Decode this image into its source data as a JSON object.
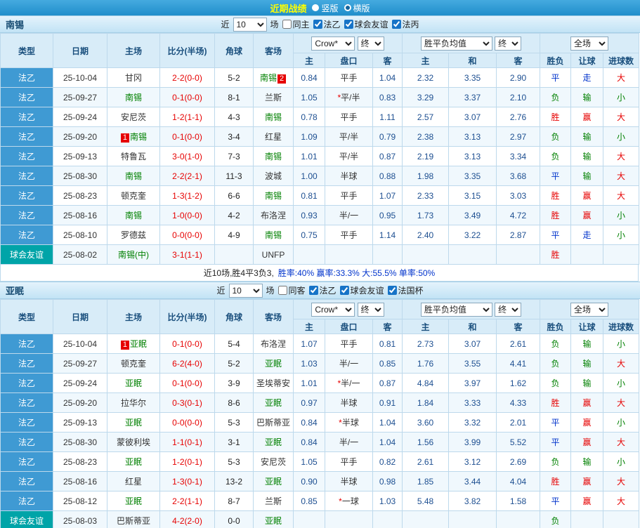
{
  "top_bar": {
    "title": "近期战绩",
    "layout_options": [
      {
        "label": "竖版",
        "selected": false
      },
      {
        "label": "横版",
        "selected": true
      }
    ]
  },
  "palette": {
    "topbar_blue": "#2f9ad3",
    "title_yellow": "#ffff00",
    "league_blue": "#3f9ad3",
    "friendly_teal": "#00a4a8",
    "win_red": "#e60000",
    "draw_blue": "#0033cc",
    "loss_green": "#008000",
    "odds_navy": "#1d4f91"
  },
  "sections": [
    {
      "team": "南锡",
      "filters": {
        "near_label": "近",
        "count_value": "10",
        "unit_label": "场",
        "checkboxes": [
          {
            "label": "同主",
            "checked": false
          },
          {
            "label": "法乙",
            "checked": true
          },
          {
            "label": "球会友谊",
            "checked": true
          },
          {
            "label": "法丙",
            "checked": true
          }
        ]
      },
      "selectors": {
        "odds_company": "Crow*",
        "odds_stage": "终",
        "europe_odds": "胜平负均值",
        "europe_stage": "终",
        "scope": "全场"
      },
      "columns": {
        "static": [
          "类型",
          "日期",
          "主场",
          "比分(半场)",
          "角球",
          "客场"
        ],
        "asia": [
          "主",
          "盘口",
          "客"
        ],
        "europe": [
          "主",
          "和",
          "客"
        ],
        "scope": [
          "胜负",
          "让球",
          "进球数"
        ]
      },
      "rows": [
        {
          "type": "法乙",
          "date": "25-10-04",
          "home": "甘冈",
          "home_focal": false,
          "score": "2-2(0-0)",
          "corner": "5-2",
          "away": "南锡",
          "away_focal": true,
          "away_badge": "2",
          "away_badge_side": "right",
          "asia_home": "0.84",
          "handicap": "平手",
          "asia_away": "1.04",
          "euro_home": "2.32",
          "euro_draw": "3.35",
          "euro_away": "2.90",
          "result": "平",
          "handicap_result": "走",
          "goals": "大"
        },
        {
          "type": "法乙",
          "date": "25-09-27",
          "home": "南锡",
          "home_focal": true,
          "score": "0-1(0-0)",
          "corner": "8-1",
          "away": "兰斯",
          "away_focal": false,
          "asia_home": "1.05",
          "handicap": "*平/半",
          "asia_away": "0.83",
          "euro_home": "3.29",
          "euro_draw": "3.37",
          "euro_away": "2.10",
          "result": "负",
          "handicap_result": "输",
          "goals": "小"
        },
        {
          "type": "法乙",
          "date": "25-09-24",
          "home": "安尼茨",
          "home_focal": false,
          "score": "1-2(1-1)",
          "corner": "4-3",
          "away": "南锡",
          "away_focal": true,
          "asia_home": "0.78",
          "handicap": "平手",
          "asia_away": "1.11",
          "euro_home": "2.57",
          "euro_draw": "3.07",
          "euro_away": "2.76",
          "result": "胜",
          "handicap_result": "赢",
          "goals": "大"
        },
        {
          "type": "法乙",
          "date": "25-09-20",
          "home": "南锡",
          "home_focal": true,
          "home_badge": "1",
          "home_badge_side": "left",
          "score": "0-1(0-0)",
          "corner": "3-4",
          "away": "红星",
          "away_focal": false,
          "asia_home": "1.09",
          "handicap": "平/半",
          "asia_away": "0.79",
          "euro_home": "2.38",
          "euro_draw": "3.13",
          "euro_away": "2.97",
          "result": "负",
          "handicap_result": "输",
          "goals": "小"
        },
        {
          "type": "法乙",
          "date": "25-09-13",
          "home": "特鲁瓦",
          "home_focal": false,
          "score": "3-0(1-0)",
          "corner": "7-3",
          "away": "南锡",
          "away_focal": true,
          "asia_home": "1.01",
          "handicap": "平/半",
          "asia_away": "0.87",
          "euro_home": "2.19",
          "euro_draw": "3.13",
          "euro_away": "3.34",
          "result": "负",
          "handicap_result": "输",
          "goals": "大"
        },
        {
          "type": "法乙",
          "date": "25-08-30",
          "home": "南锡",
          "home_focal": true,
          "score": "2-2(2-1)",
          "corner": "11-3",
          "away": "波城",
          "away_focal": false,
          "asia_home": "1.00",
          "handicap": "半球",
          "asia_away": "0.88",
          "euro_home": "1.98",
          "euro_draw": "3.35",
          "euro_away": "3.68",
          "result": "平",
          "handicap_result": "输",
          "goals": "大"
        },
        {
          "type": "法乙",
          "date": "25-08-23",
          "home": "顿克奎",
          "home_focal": false,
          "score": "1-3(1-2)",
          "corner": "6-6",
          "away": "南锡",
          "away_focal": true,
          "asia_home": "0.81",
          "handicap": "平手",
          "asia_away": "1.07",
          "euro_home": "2.33",
          "euro_draw": "3.15",
          "euro_away": "3.03",
          "result": "胜",
          "handicap_result": "赢",
          "goals": "大"
        },
        {
          "type": "法乙",
          "date": "25-08-16",
          "home": "南锡",
          "home_focal": true,
          "score": "1-0(0-0)",
          "corner": "4-2",
          "away": "布洛涅",
          "away_focal": false,
          "asia_home": "0.93",
          "handicap": "半/一",
          "asia_away": "0.95",
          "euro_home": "1.73",
          "euro_draw": "3.49",
          "euro_away": "4.72",
          "result": "胜",
          "handicap_result": "赢",
          "goals": "小"
        },
        {
          "type": "法乙",
          "date": "25-08-10",
          "home": "罗德兹",
          "home_focal": false,
          "score": "0-0(0-0)",
          "corner": "4-9",
          "away": "南锡",
          "away_focal": true,
          "asia_home": "0.75",
          "handicap": "平手",
          "asia_away": "1.14",
          "euro_home": "2.40",
          "euro_draw": "3.22",
          "euro_away": "2.87",
          "result": "平",
          "handicap_result": "走",
          "goals": "小"
        },
        {
          "type": "球会友谊",
          "date": "25-08-02",
          "home": "南锡(中)",
          "home_focal": true,
          "score": "3-1(1-1)",
          "corner": "",
          "away": "UNFP",
          "away_focal": false,
          "asia_home": "",
          "handicap": "",
          "asia_away": "",
          "euro_home": "",
          "euro_draw": "",
          "euro_away": "",
          "result": "胜",
          "handicap_result": "",
          "goals": ""
        }
      ],
      "summary": {
        "prefix": "近10场,胜4平3负3,",
        "stats": "胜率:40% 赢率:33.3% 大:55.5% 单率:50%"
      }
    },
    {
      "team": "亚眠",
      "filters": {
        "near_label": "近",
        "count_value": "10",
        "unit_label": "场",
        "checkboxes": [
          {
            "label": "同客",
            "checked": false
          },
          {
            "label": "法乙",
            "checked": true
          },
          {
            "label": "球会友谊",
            "checked": true
          },
          {
            "label": "法国杯",
            "checked": true
          }
        ]
      },
      "selectors": {
        "odds_company": "Crow*",
        "odds_stage": "终",
        "europe_odds": "胜平负均值",
        "europe_stage": "终",
        "scope": "全场"
      },
      "columns": {
        "static": [
          "类型",
          "日期",
          "主场",
          "比分(半场)",
          "角球",
          "客场"
        ],
        "asia": [
          "主",
          "盘口",
          "客"
        ],
        "europe": [
          "主",
          "和",
          "客"
        ],
        "scope": [
          "胜负",
          "让球",
          "进球数"
        ]
      },
      "rows": [
        {
          "type": "法乙",
          "date": "25-10-04",
          "home": "亚眠",
          "home_focal": true,
          "home_badge": "1",
          "home_badge_side": "left",
          "score": "0-1(0-0)",
          "corner": "5-4",
          "away": "布洛涅",
          "away_focal": false,
          "asia_home": "1.07",
          "handicap": "平手",
          "asia_away": "0.81",
          "euro_home": "2.73",
          "euro_draw": "3.07",
          "euro_away": "2.61",
          "result": "负",
          "handicap_result": "输",
          "goals": "小"
        },
        {
          "type": "法乙",
          "date": "25-09-27",
          "home": "顿克奎",
          "home_focal": false,
          "score": "6-2(4-0)",
          "corner": "5-2",
          "away": "亚眠",
          "away_focal": true,
          "asia_home": "1.03",
          "handicap": "半/一",
          "asia_away": "0.85",
          "euro_home": "1.76",
          "euro_draw": "3.55",
          "euro_away": "4.41",
          "result": "负",
          "handicap_result": "输",
          "goals": "大"
        },
        {
          "type": "法乙",
          "date": "25-09-24",
          "home": "亚眠",
          "home_focal": true,
          "score": "0-1(0-0)",
          "corner": "3-9",
          "away": "圣埃蒂安",
          "away_focal": false,
          "asia_home": "1.01",
          "handicap": "*半/一",
          "asia_away": "0.87",
          "euro_home": "4.84",
          "euro_draw": "3.97",
          "euro_away": "1.62",
          "result": "负",
          "handicap_result": "输",
          "goals": "小"
        },
        {
          "type": "法乙",
          "date": "25-09-20",
          "home": "拉华尔",
          "home_focal": false,
          "score": "0-3(0-1)",
          "corner": "8-6",
          "away": "亚眠",
          "away_focal": true,
          "asia_home": "0.97",
          "handicap": "半球",
          "asia_away": "0.91",
          "euro_home": "1.84",
          "euro_draw": "3.33",
          "euro_away": "4.33",
          "result": "胜",
          "handicap_result": "赢",
          "goals": "大"
        },
        {
          "type": "法乙",
          "date": "25-09-13",
          "home": "亚眠",
          "home_focal": true,
          "score": "0-0(0-0)",
          "corner": "5-3",
          "away": "巴斯蒂亚",
          "away_focal": false,
          "asia_home": "0.84",
          "handicap": "*半球",
          "asia_away": "1.04",
          "euro_home": "3.60",
          "euro_draw": "3.32",
          "euro_away": "2.01",
          "result": "平",
          "handicap_result": "赢",
          "goals": "小"
        },
        {
          "type": "法乙",
          "date": "25-08-30",
          "home": "蒙彼利埃",
          "home_focal": false,
          "score": "1-1(0-1)",
          "corner": "3-1",
          "away": "亚眠",
          "away_focal": true,
          "asia_home": "0.84",
          "handicap": "半/一",
          "asia_away": "1.04",
          "euro_home": "1.56",
          "euro_draw": "3.99",
          "euro_away": "5.52",
          "result": "平",
          "handicap_result": "赢",
          "goals": "大"
        },
        {
          "type": "法乙",
          "date": "25-08-23",
          "home": "亚眠",
          "home_focal": true,
          "score": "1-2(0-1)",
          "corner": "5-3",
          "away": "安尼茨",
          "away_focal": false,
          "asia_home": "1.05",
          "handicap": "平手",
          "asia_away": "0.82",
          "euro_home": "2.61",
          "euro_draw": "3.12",
          "euro_away": "2.69",
          "result": "负",
          "handicap_result": "输",
          "goals": "小"
        },
        {
          "type": "法乙",
          "date": "25-08-16",
          "home": "红星",
          "home_focal": false,
          "score": "1-3(0-1)",
          "corner": "13-2",
          "away": "亚眠",
          "away_focal": true,
          "asia_home": "0.90",
          "handicap": "半球",
          "asia_away": "0.98",
          "euro_home": "1.85",
          "euro_draw": "3.44",
          "euro_away": "4.04",
          "result": "胜",
          "handicap_result": "赢",
          "goals": "大"
        },
        {
          "type": "法乙",
          "date": "25-08-12",
          "home": "亚眠",
          "home_focal": true,
          "score": "2-2(1-1)",
          "corner": "8-7",
          "away": "兰斯",
          "away_focal": false,
          "asia_home": "0.85",
          "handicap": "*一球",
          "asia_away": "1.03",
          "euro_home": "5.48",
          "euro_draw": "3.82",
          "euro_away": "1.58",
          "result": "平",
          "handicap_result": "赢",
          "goals": "大"
        },
        {
          "type": "球会友谊",
          "date": "25-08-03",
          "home": "巴斯蒂亚",
          "home_focal": false,
          "score": "4-2(2-0)",
          "corner": "0-0",
          "away": "亚眠",
          "away_focal": true,
          "asia_home": "",
          "handicap": "",
          "asia_away": "",
          "euro_home": "",
          "euro_draw": "",
          "euro_away": "",
          "result": "负",
          "handicap_result": "",
          "goals": ""
        }
      ]
    }
  ]
}
